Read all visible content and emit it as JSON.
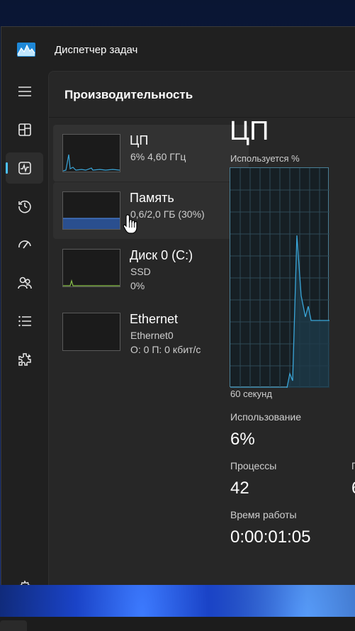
{
  "window": {
    "title": "Диспетчер задач"
  },
  "nav": {
    "items": [
      {
        "name": "hamburger-menu-icon"
      },
      {
        "name": "processes-icon"
      },
      {
        "name": "performance-icon",
        "active": true
      },
      {
        "name": "app-history-icon"
      },
      {
        "name": "startup-apps-icon"
      },
      {
        "name": "users-icon"
      },
      {
        "name": "details-icon"
      },
      {
        "name": "services-icon"
      },
      {
        "name": "settings-icon"
      }
    ]
  },
  "content": {
    "header": "Производительность"
  },
  "perf_list": [
    {
      "name": "ЦП",
      "sub1": "6%  4,60 ГГц",
      "sub2": "",
      "accent": "#3aa6d9"
    },
    {
      "name": "Память",
      "sub1": "0,6/2,0 ГБ (30%)",
      "sub2": "",
      "accent": "#4a7fd4"
    },
    {
      "name": "Диск 0 (C:)",
      "sub1": "SSD",
      "sub2": "0%",
      "accent": "#8bc34a"
    },
    {
      "name": "Ethernet",
      "sub1": "Ethernet0",
      "sub2": "О: 0 П: 0 кбит/с",
      "accent": "#a0a0a0"
    }
  ],
  "detail": {
    "title": "ЦП",
    "graph_label": "Используется %",
    "graph_footer": "60 секунд",
    "utilization_label": "Использование",
    "utilization_value": "6%",
    "processes_label": "Процессы",
    "processes_value": "42",
    "threads_label_partial": "П",
    "threads_value_partial": "6",
    "uptime_label": "Время работы",
    "uptime_value": "0:00:01:05"
  },
  "colors": {
    "accent": "#4cc2ff",
    "cpu_line": "#3aa6d9",
    "memory_fill": "#2a4f8f"
  }
}
